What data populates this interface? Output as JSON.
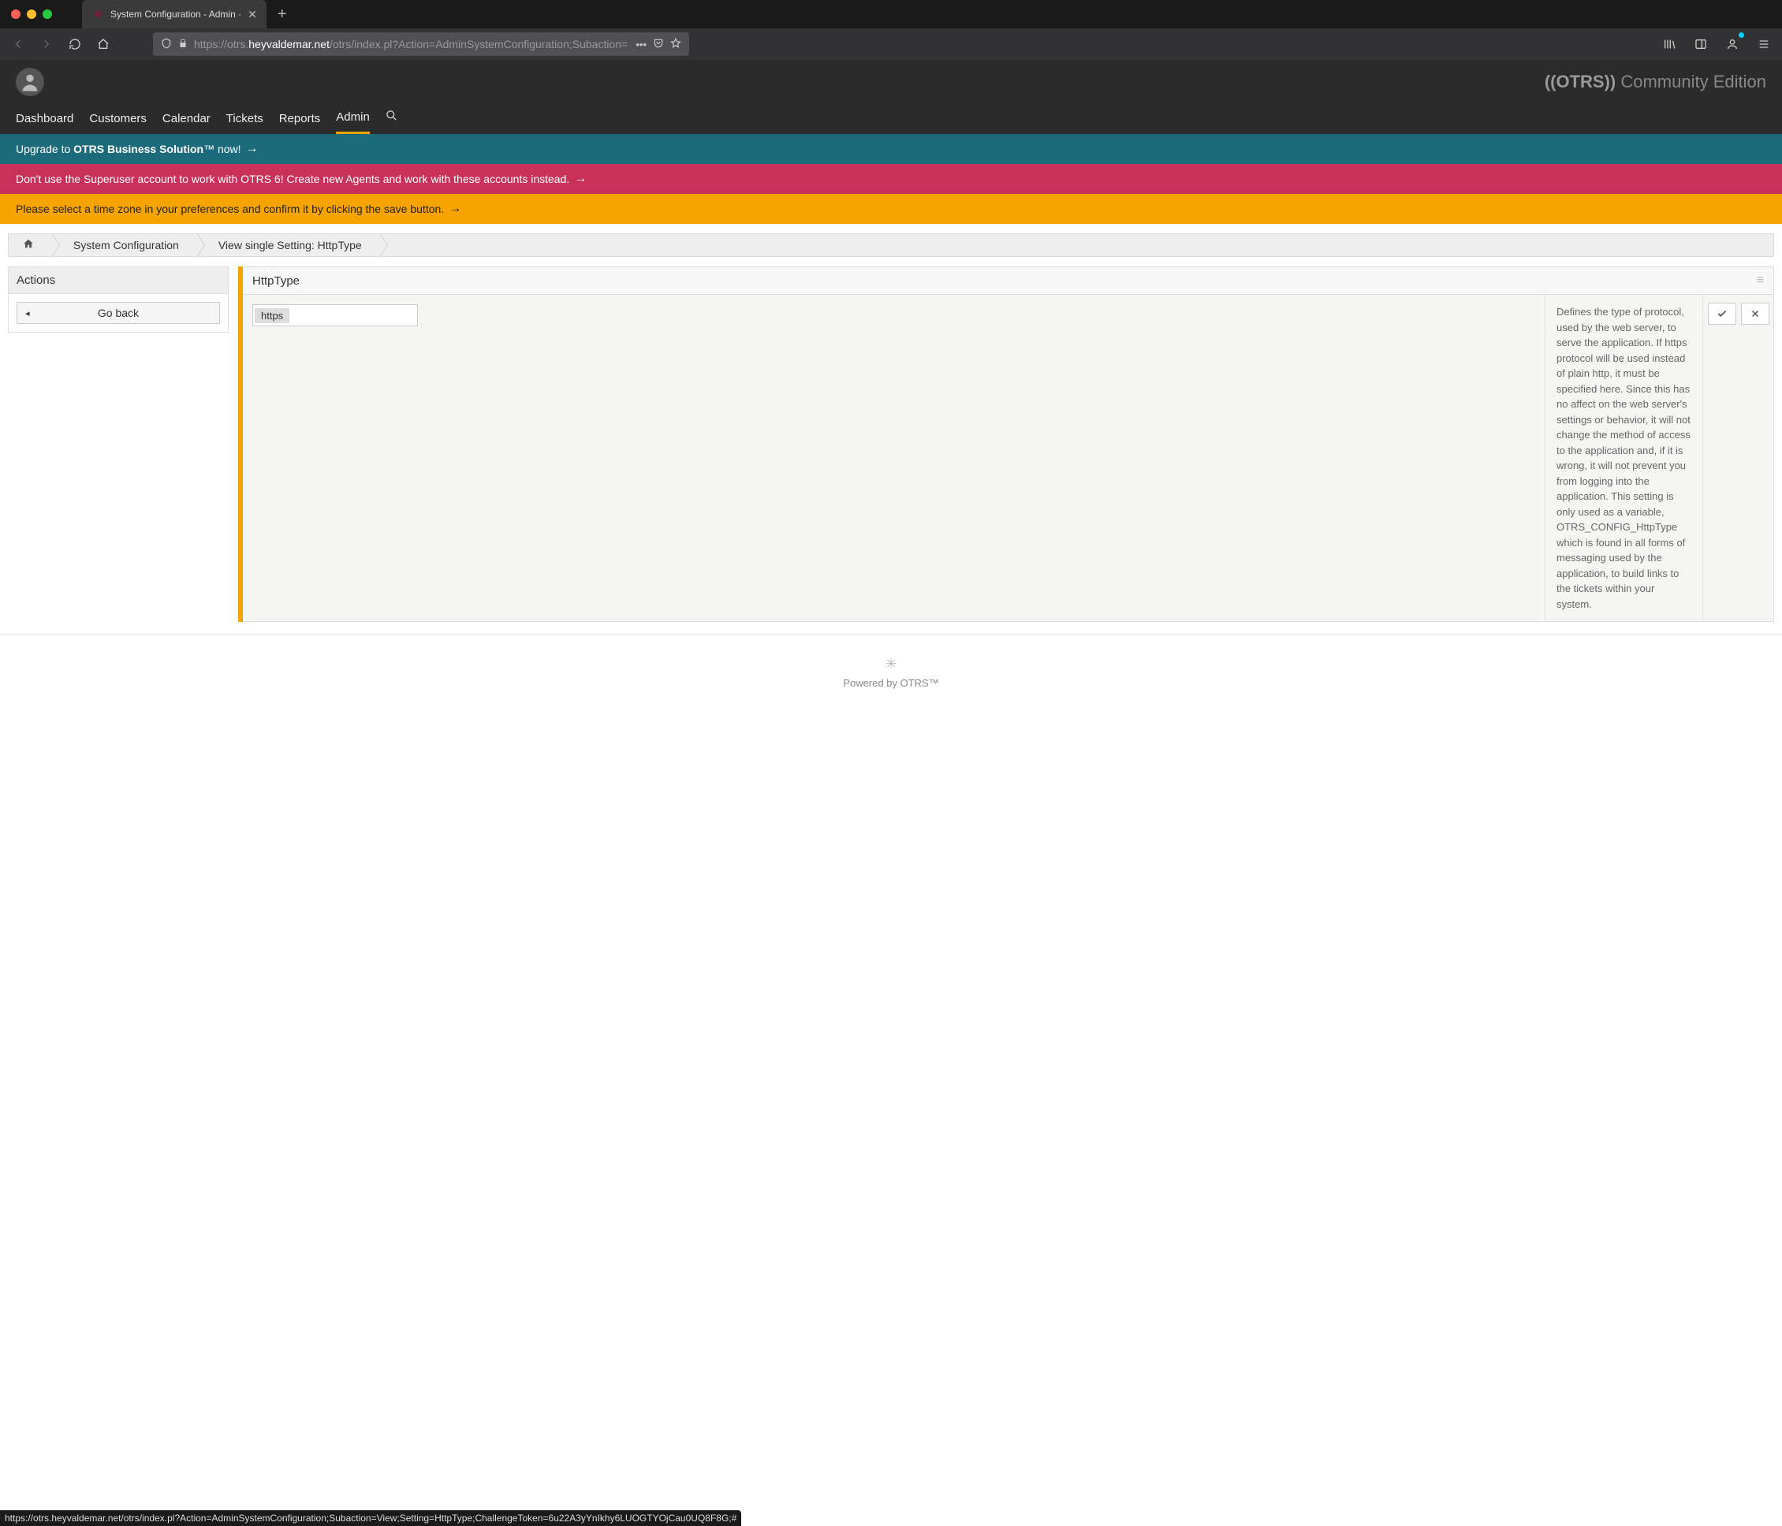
{
  "browser": {
    "tab_title": "System Configuration - Admin ·",
    "url_prefix": "https://otrs.",
    "url_domain": "heyvaldemar.net",
    "url_path": "/otrs/index.pl?Action=AdminSystemConfiguration;Subaction="
  },
  "app": {
    "brand_strong": "((OTRS))",
    "brand_rest": " Community Edition",
    "nav": {
      "dashboard": "Dashboard",
      "customers": "Customers",
      "calendar": "Calendar",
      "tickets": "Tickets",
      "reports": "Reports",
      "admin": "Admin"
    }
  },
  "banners": {
    "upgrade_pre": "Upgrade to ",
    "upgrade_bold": "OTRS Business Solution",
    "upgrade_tm": "™",
    "upgrade_post": " now!",
    "superuser": "Don't use the Superuser account to work with OTRS 6! Create new Agents and work with these accounts instead.",
    "timezone": "Please select a time zone in your preferences and confirm it by clicking the save button."
  },
  "breadcrumb": {
    "sysconfig": "System Configuration",
    "view": "View single Setting: HttpType"
  },
  "sidebar": {
    "actions_title": "Actions",
    "go_back": "Go back"
  },
  "setting": {
    "title": "HttpType",
    "value": "https",
    "description": "Defines the type of protocol, used by the web server, to serve the application. If https protocol will be used instead of plain http, it must be specified here. Since this has no affect on the web server's settings or behavior, it will not change the method of access to the application and, if it is wrong, it will not prevent you from logging into the application. This setting is only used as a variable, OTRS_CONFIG_HttpType which is found in all forms of messaging used by the application, to build links to the tickets within your system."
  },
  "footer": {
    "powered": "Powered by OTRS™"
  },
  "status_bar": "https://otrs.heyvaldemar.net/otrs/index.pl?Action=AdminSystemConfiguration;Subaction=View;Setting=HttpType;ChallengeToken=6u22A3yYnIkhy6LUOGTYOjCau0UQ8F8G;#"
}
